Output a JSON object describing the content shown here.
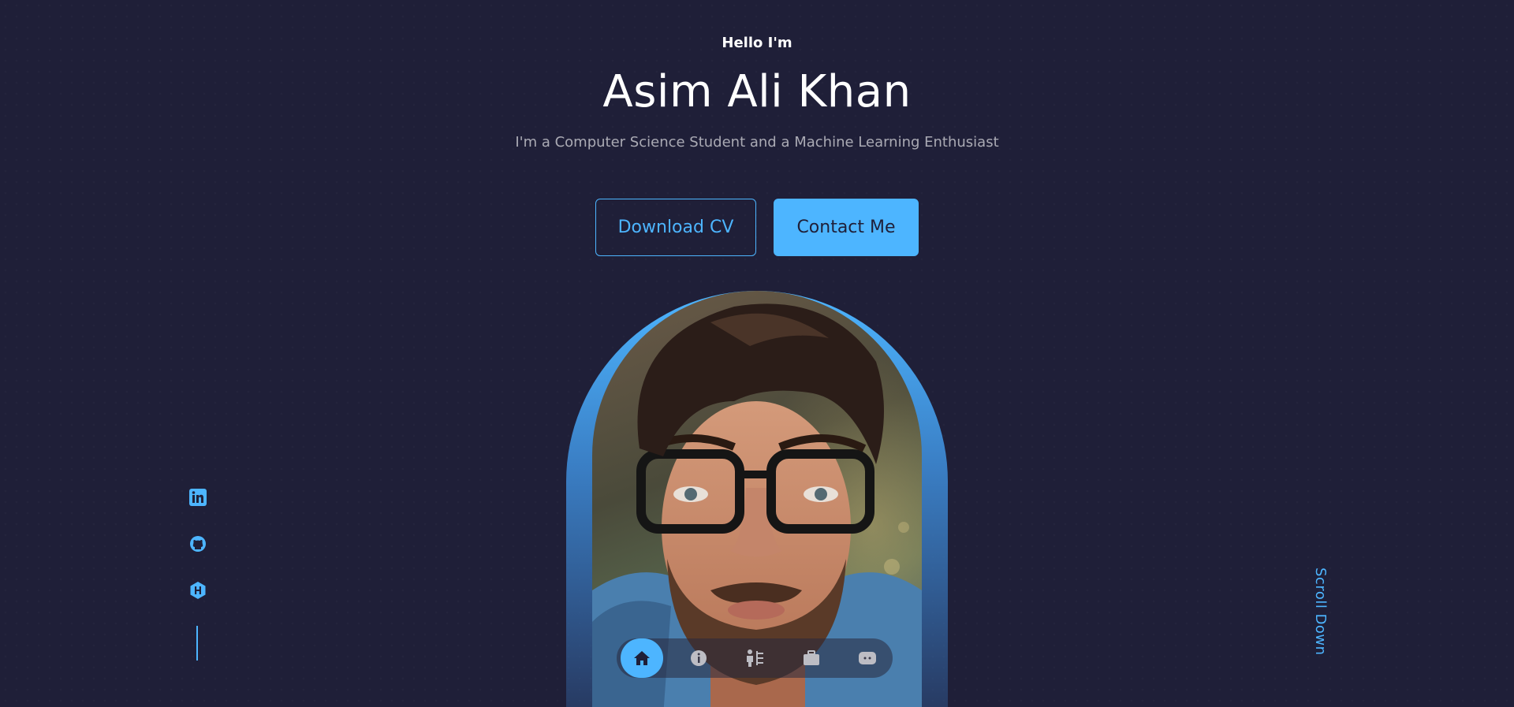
{
  "hero": {
    "greeting": "Hello I'm",
    "name": "Asim Ali Khan",
    "tagline": "I'm a Computer Science Student and a Machine Learning Enthusiast"
  },
  "buttons": {
    "download_cv": "Download CV",
    "contact_me": "Contact Me"
  },
  "socials": [
    {
      "icon": "linkedin-icon"
    },
    {
      "icon": "github-icon"
    },
    {
      "icon": "hashnode-icon"
    }
  ],
  "nav": {
    "items": [
      {
        "icon": "home-icon",
        "active": true
      },
      {
        "icon": "info-icon",
        "active": false
      },
      {
        "icon": "skills-icon",
        "active": false
      },
      {
        "icon": "briefcase-icon",
        "active": false
      },
      {
        "icon": "chat-icon",
        "active": false
      }
    ]
  },
  "scroll": {
    "label": "Scroll Down"
  },
  "colors": {
    "background": "#1f1f38",
    "accent": "#4db5ff",
    "text": "#ffffff",
    "muted_text": "rgba(255,255,255,0.62)"
  }
}
